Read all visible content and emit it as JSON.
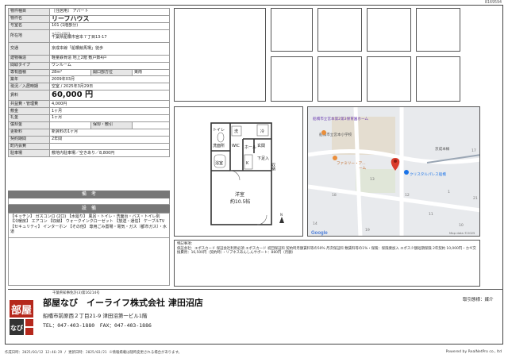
{
  "doc_id": "8169594",
  "spec_rows": [
    {
      "key": "物件種目",
      "value": "［住居用］ アパート"
    },
    {
      "key": "物件名",
      "value": "リーフハウス"
    },
    {
      "key": "号室名",
      "value": "101 (1階部分)"
    },
    {
      "key": "所在地",
      "value": "千葉県船橋市宮本７丁目13-17",
      "sub": "〒273-0003"
    },
    {
      "key": "交通",
      "value": "京成本線「船橋競馬場」徒歩"
    },
    {
      "key": "建物構造",
      "value": "軽量鉄骨造 地上2階 敷戸数4戸"
    },
    {
      "key": "間取タイプ",
      "value": "ワンルーム"
    },
    {
      "key": "専有面積",
      "value": "28m²",
      "extra_key": "開口部方位",
      "extra_value": "東南"
    },
    {
      "key": "築年",
      "value": "2009年03月"
    },
    {
      "key": "現況／入居時期",
      "value": "空室 / 2025年3月29日"
    },
    {
      "key": "賃料",
      "value": "60,000 円"
    },
    {
      "key": "共益費・管理費",
      "value": "4,000円"
    },
    {
      "key": "敷金",
      "value": "1ヶ月"
    },
    {
      "key": "礼金",
      "value": "1ヶ月",
      "extra_key": "",
      "extra_value": ""
    },
    {
      "key": "償却金",
      "value": "",
      "extra_key": "保却・敷引",
      "extra_value": ""
    },
    {
      "key": "更新料",
      "value": "新賃料の1ヶ月"
    },
    {
      "key": "契約期間",
      "value": "2年間"
    },
    {
      "key": "町内会費",
      "value": ""
    },
    {
      "key": "駐車場",
      "value": "敷地内駐車場／空きあり／8,800円"
    }
  ],
  "remarks_header": "備　考",
  "equipment_header": "設　備",
  "equipment_text": "【キッチン】 ガスコンロ (2口) 【水廻り】 風呂・トイレ・洗面台・バス・トイレ別 【冷暖房】 エアコン 【収納】 ウォークインクローゼット 【放送・通信】 ケーブルTV 【セキュリティ】 インターホン 【その他】 専用ごみ置場・電気・ガス（都市ガス）・水道",
  "floorplan": {
    "rooms": [
      "洗",
      "冷",
      "WIC",
      "玄関",
      "ホール",
      "K",
      "浴室",
      "トイレ",
      "下足入",
      "洗面所",
      "洋室",
      "約10.5帖"
    ],
    "vertical_room": "収納"
  },
  "map": {
    "labels": [
      "船橋市立宮本第2第3保育園ホーム",
      "船橋市立宮本小学校",
      "ファミリー・ア...",
      "ーム",
      "クリスタルパレス船橋",
      "京成本線"
    ],
    "numbers": [
      "17",
      "11",
      "13",
      "18",
      "19",
      "21",
      "10",
      "1",
      "12",
      "14"
    ],
    "google": "Google",
    "copyright": "Map data ©2025"
  },
  "notes": {
    "header": "特記事項：",
    "body": "保証会社：エポスカード 保証会社利用必須 エポスカード 初回保証料 契約時月額賃料等の50% 月次保証料 敷賃料等の1%・保険：保険要加入 エポス少額短期保険 2年契約 10,000円・カギ交換費用：16,500円（契約時）・リブネスあんしんサポート：880円（月額）"
  },
  "footer": {
    "license": "千葉県知事免許(3)第16214号",
    "company": "部屋なび　イーライフ株式会社 津田沼店",
    "address": "船橋市前原西２丁目21-9 津田沼第一ビル1階",
    "tel": "TEL：047-403-1880　FAX：047-403-1886",
    "trade_type": "取引態様：媒介",
    "print_info": "作成日時：2025/03/12 12:46:29 / 更新日時：2025/03/21 ※情報掲載は随時変更される場合があります。",
    "powered": "Powered by RealNetPro co., ltd"
  },
  "logo": {
    "big": "部屋",
    "small": "なび"
  },
  "colors": {
    "header_bg": "#777777",
    "key_bg": "#e6e6e6",
    "logo_red": "#b5281c",
    "pin": "#d93b2b"
  }
}
